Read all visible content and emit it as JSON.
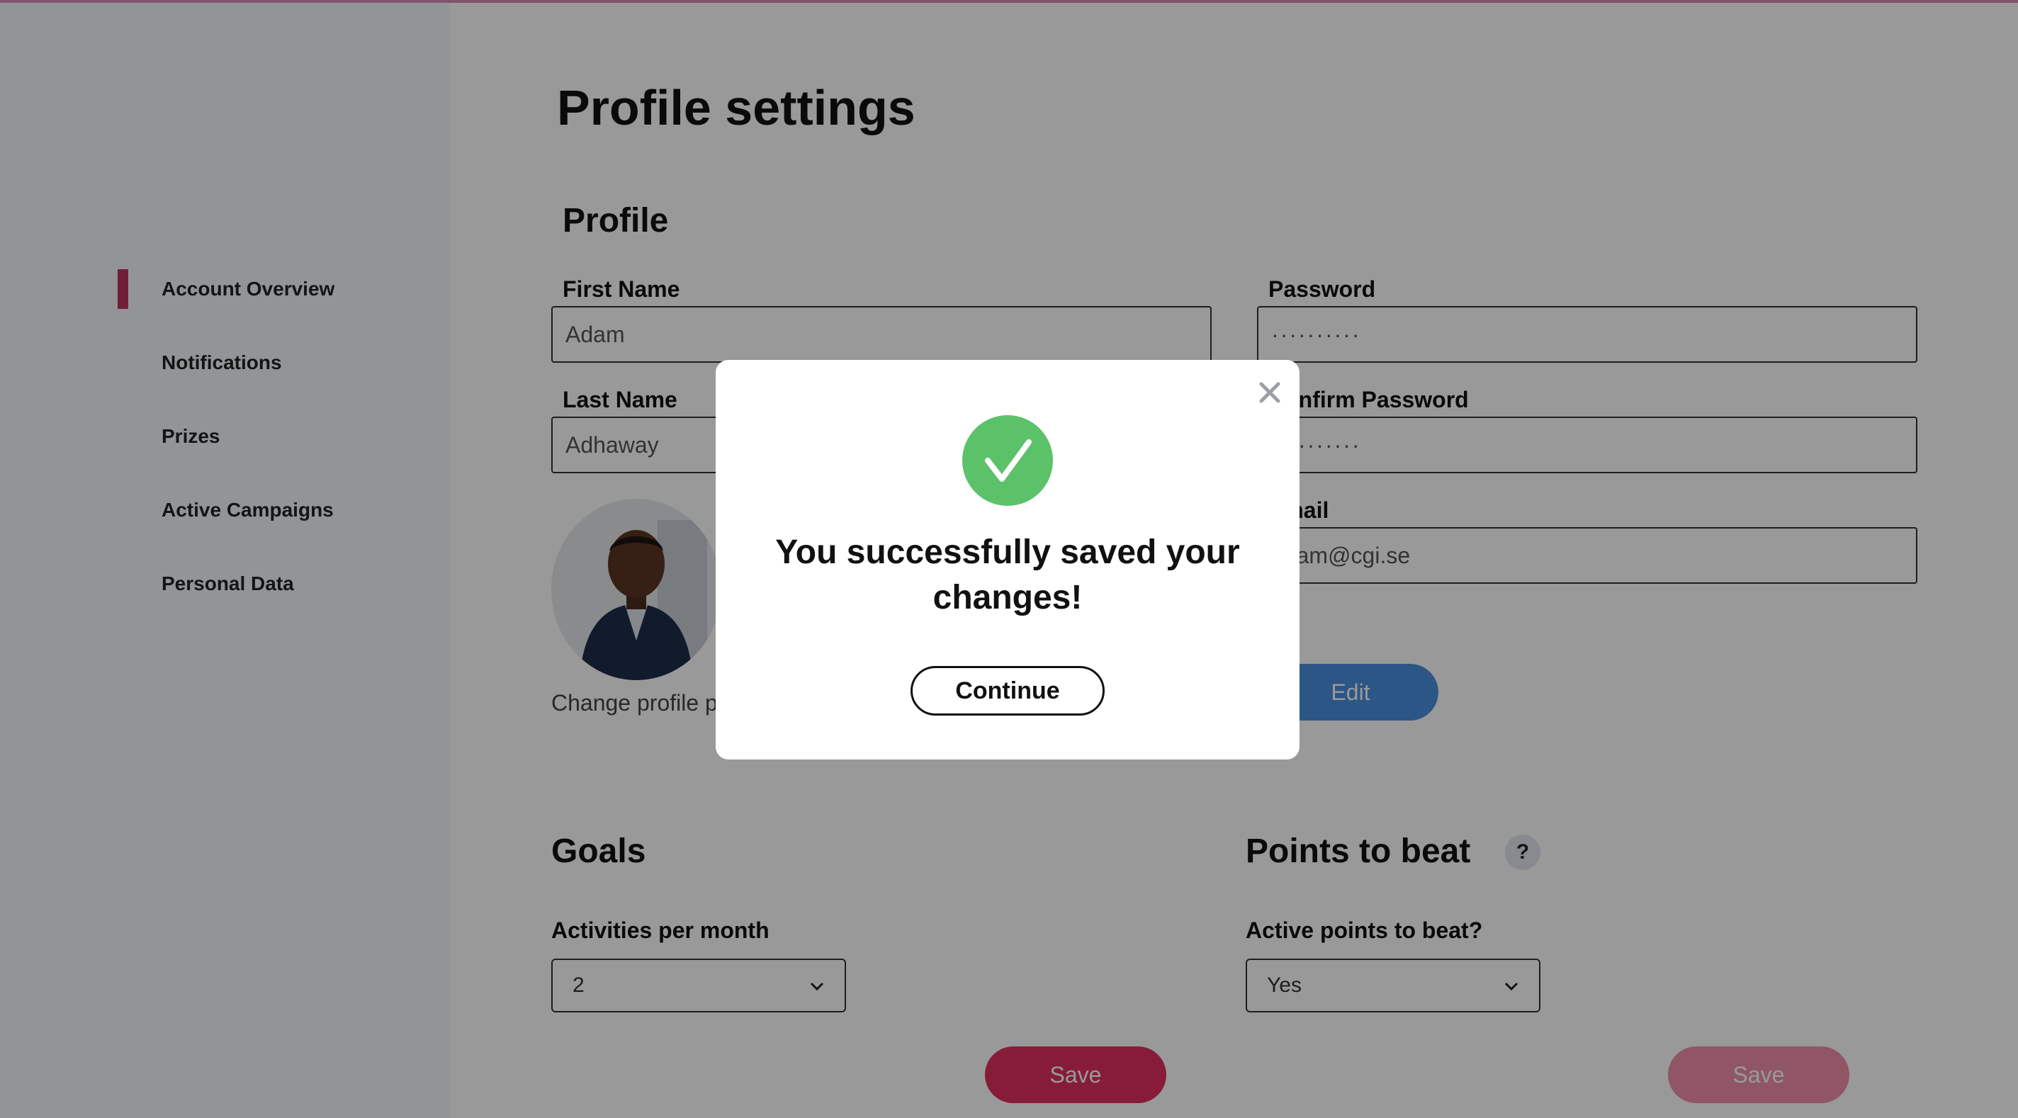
{
  "sidebar": {
    "items": [
      {
        "label": "Account Overview",
        "active": true
      },
      {
        "label": "Notifications",
        "active": false
      },
      {
        "label": "Prizes",
        "active": false
      },
      {
        "label": "Active Campaigns",
        "active": false
      },
      {
        "label": "Personal Data",
        "active": false
      }
    ]
  },
  "page": {
    "title": "Profile settings",
    "profile_section_title": "Profile"
  },
  "profile": {
    "first_name_label": "First Name",
    "first_name_value": "Adam",
    "last_name_label": "Last Name",
    "last_name_value": "Adhaway",
    "password_label": "Password",
    "password_value": "··········",
    "confirm_password_label": "Confirm Password",
    "confirm_password_value": "··········",
    "email_label": "Email",
    "email_value": "adam@cgi.se",
    "change_picture_label": "Change profile picture",
    "edit_button": "Edit"
  },
  "goals": {
    "title": "Goals",
    "activities_label": "Activities per month",
    "activities_value": "2",
    "save_button": "Save"
  },
  "points": {
    "title": "Points to beat",
    "help_label": "?",
    "active_label": "Active points to beat?",
    "active_value": "Yes",
    "save_button": "Save"
  },
  "modal": {
    "message": "You successfully saved your changes!",
    "continue_button": "Continue"
  },
  "colors": {
    "accent": "#c0335f",
    "edit_blue": "#4a8fe0",
    "success_green": "#5cc26a"
  },
  "icons": {
    "close": "close-icon",
    "check": "check-circle-icon",
    "chevron": "chevron-down-icon",
    "help": "help-icon"
  }
}
